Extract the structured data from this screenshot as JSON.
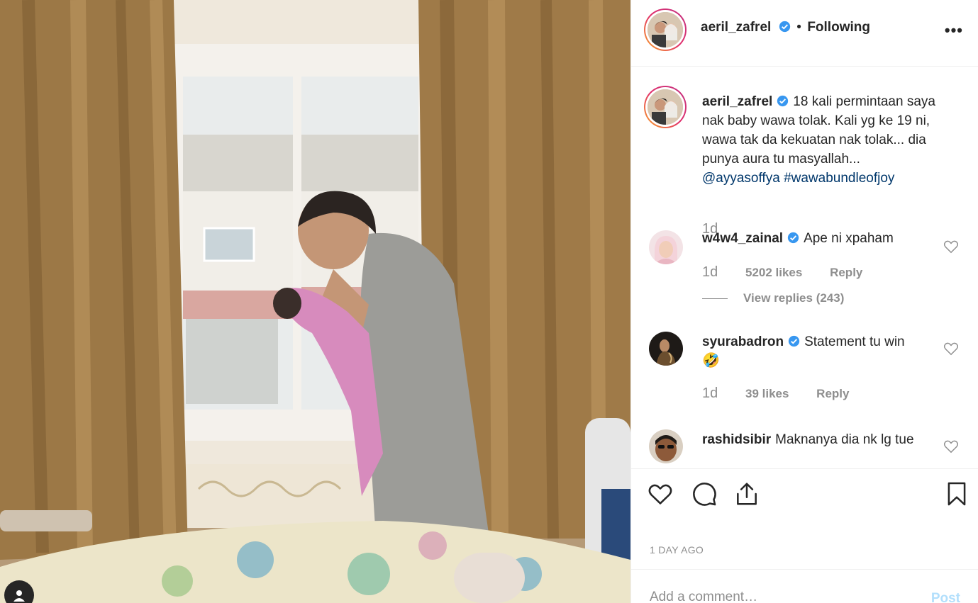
{
  "post": {
    "author": "aeril_zafrel",
    "follow_state": "Following",
    "dot": "•",
    "more_label": "•••",
    "caption_author": "aeril_zafrel",
    "caption_text": "18 kali permintaan saya nak baby wawa tolak. Kali yg ke 19 ni, wawa tak da kekuatan nak tolak... dia punya aura tu masyallah...",
    "caption_mention": "@ayyasoffya",
    "caption_hashtag": "#wawabundleofjoy",
    "caption_time": "1d",
    "date": "1 DAY AGO"
  },
  "comments": [
    {
      "user": "w4w4_zainal",
      "verified": true,
      "text": "Ape ni xpaham",
      "time": "1d",
      "likes": "5202 likes",
      "reply": "Reply",
      "view_replies": "View replies (243)"
    },
    {
      "user": "syurabadron",
      "verified": true,
      "text": "Statement tu win",
      "emoji": "🤣",
      "time": "1d",
      "likes": "39 likes",
      "reply": "Reply"
    },
    {
      "user": "rashidsibir",
      "verified": false,
      "text": "Maknanya dia nk lg tue"
    }
  ],
  "add_comment": {
    "placeholder": "Add a comment…",
    "post_label": "Post"
  },
  "colors": {
    "link": "#00376b",
    "verified": "#3897f0",
    "muted": "#8e8e8e"
  }
}
